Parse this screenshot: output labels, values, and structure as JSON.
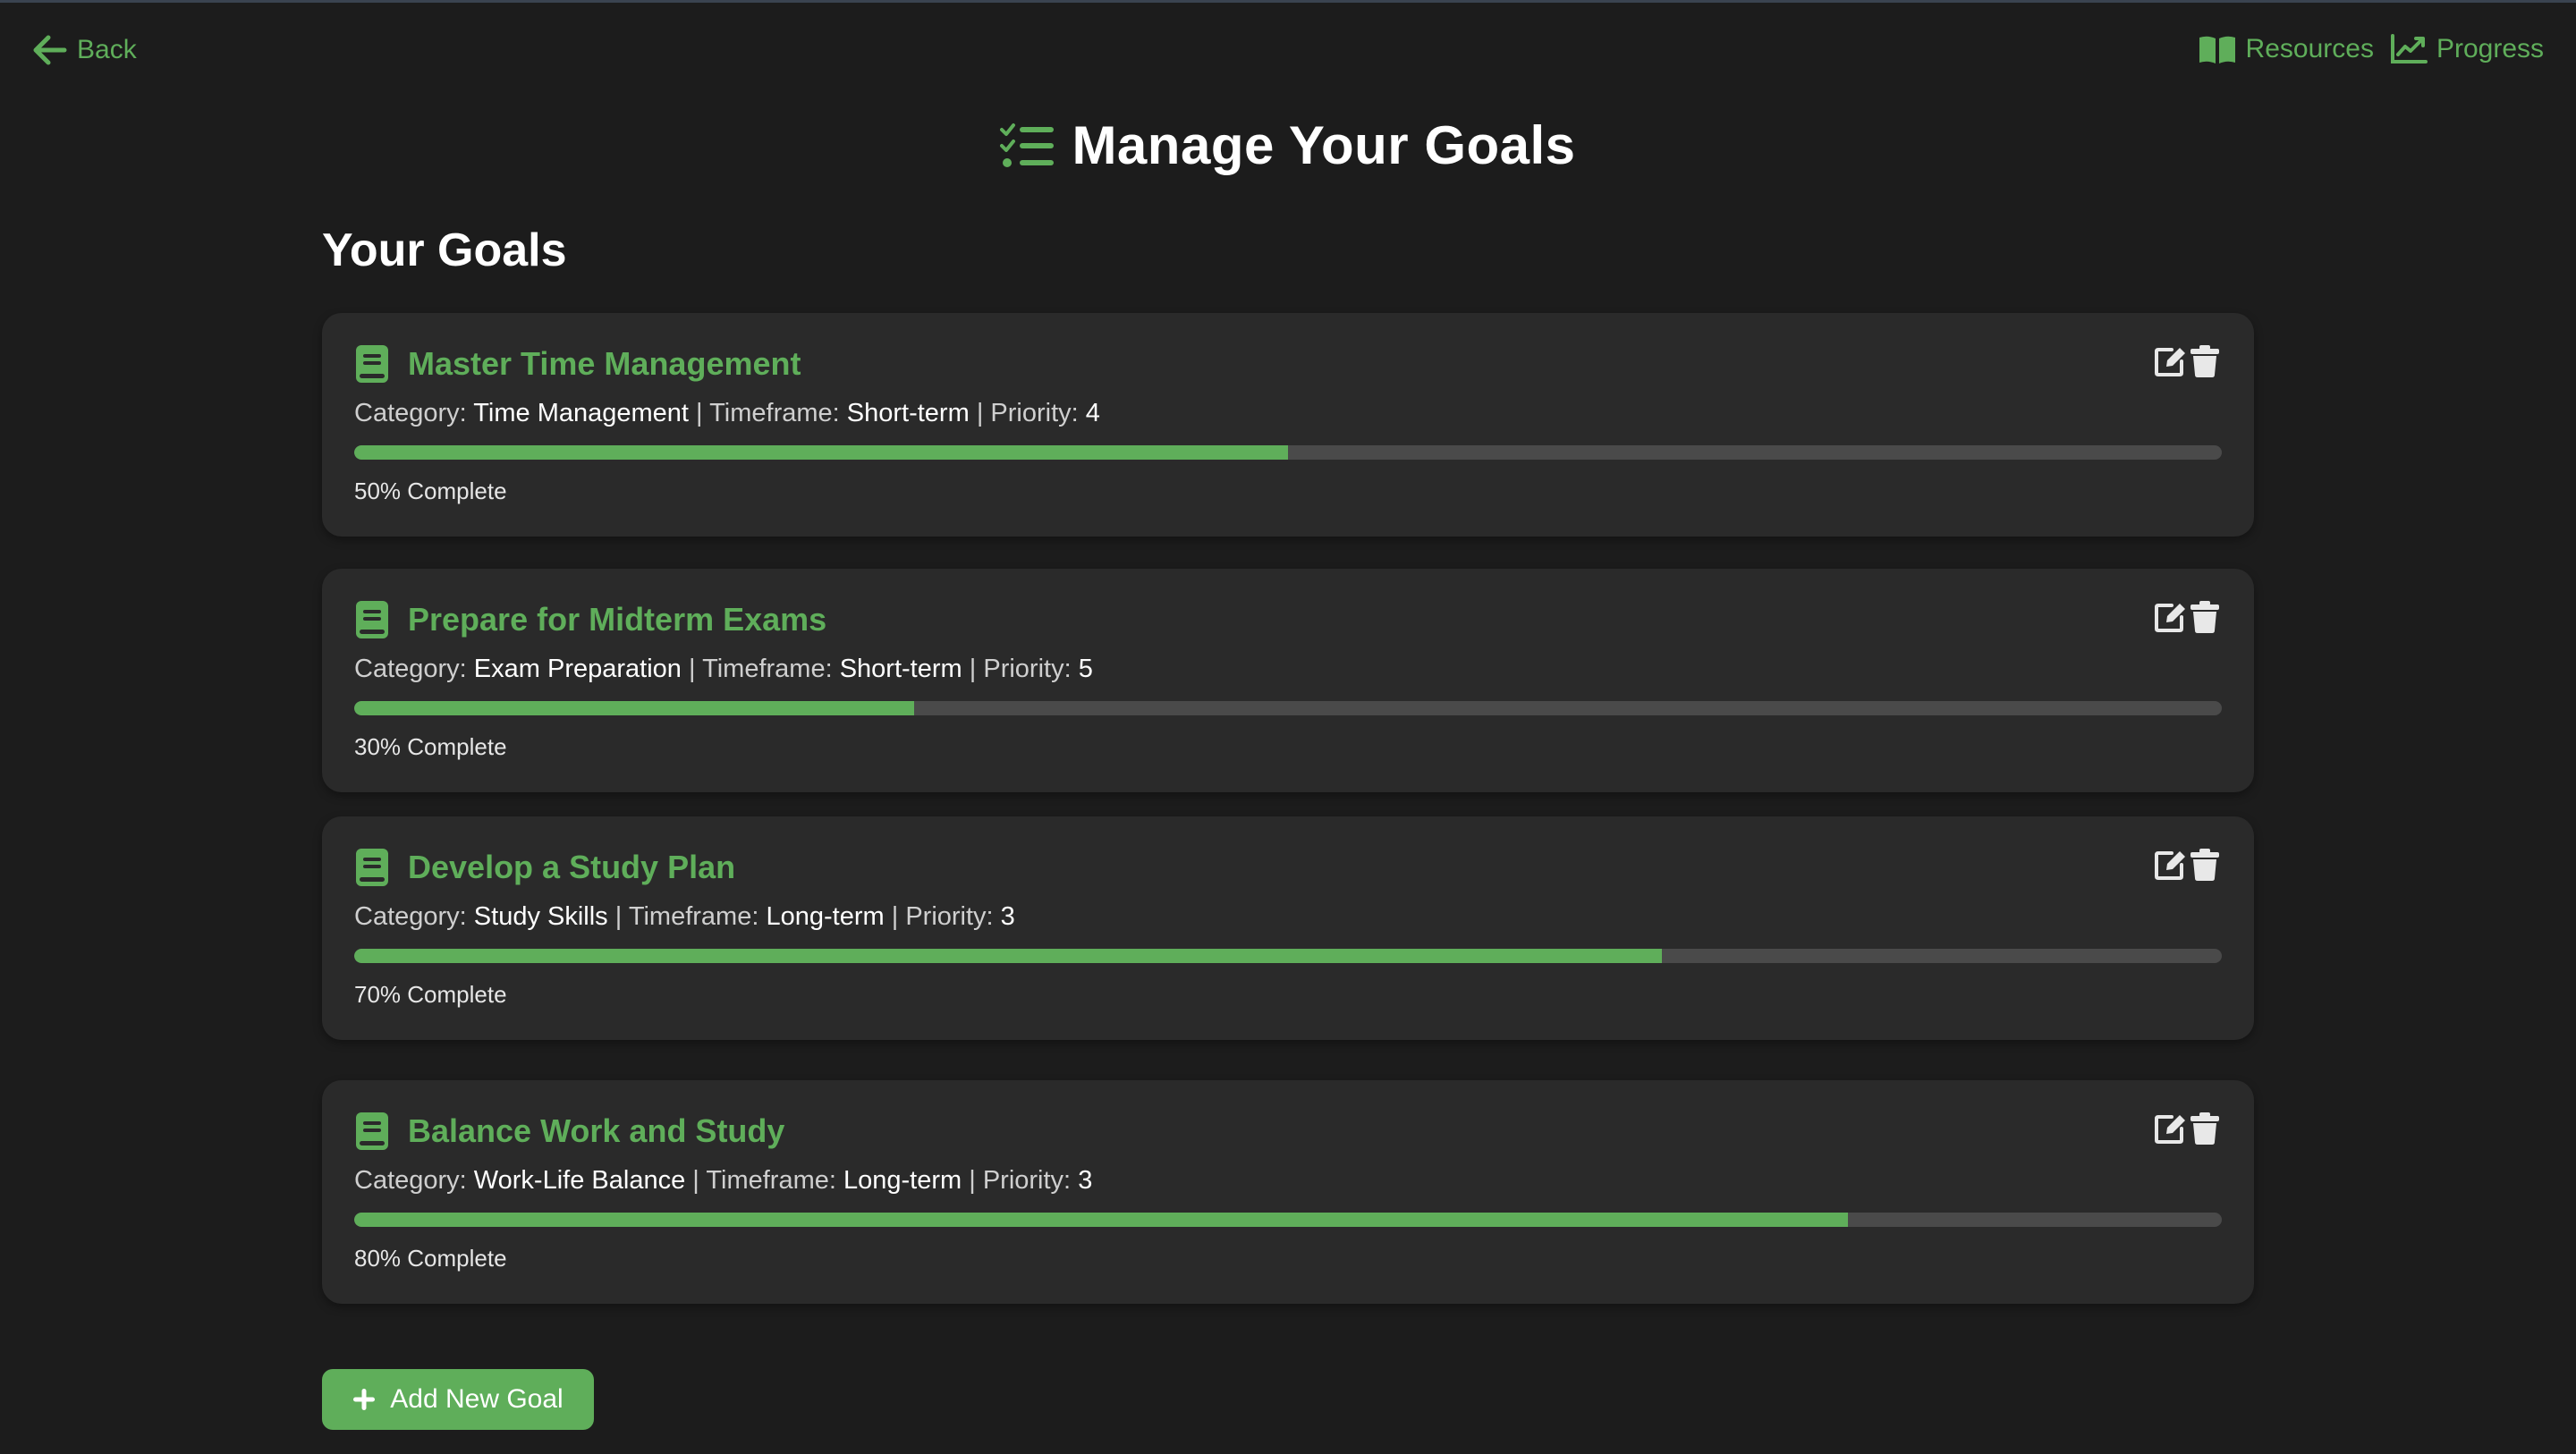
{
  "nav": {
    "back_label": "Back",
    "resources_label": "Resources",
    "progress_label": "Progress"
  },
  "page": {
    "title": "Manage Your Goals",
    "section_title": "Your Goals"
  },
  "labels": {
    "category": "Category:",
    "timeframe": "Timeframe:",
    "priority": "Priority:",
    "separator": "|"
  },
  "goals": [
    {
      "title": "Master Time Management",
      "category": "Time Management",
      "timeframe": "Short-term",
      "priority": "4",
      "progress": 50,
      "progress_text": "50% Complete"
    },
    {
      "title": "Prepare for Midterm Exams",
      "category": "Exam Preparation",
      "timeframe": "Short-term",
      "priority": "5",
      "progress": 30,
      "progress_text": "30% Complete"
    },
    {
      "title": "Develop a Study Plan",
      "category": "Study Skills",
      "timeframe": "Long-term",
      "priority": "3",
      "progress": 70,
      "progress_text": "70% Complete"
    },
    {
      "title": "Balance Work and Study",
      "category": "Work-Life Balance",
      "timeframe": "Long-term",
      "priority": "3",
      "progress": 80,
      "progress_text": "80% Complete"
    }
  ],
  "add_button_label": "Add New Goal",
  "colors": {
    "accent": "#5fae5a",
    "background": "#1c1c1c",
    "card": "#2a2a2a",
    "track": "#4a4a4a"
  },
  "icons": {
    "back": "arrow-left-icon",
    "resources": "book-open-icon",
    "progress": "chart-line-icon",
    "title": "checklist-icon",
    "goal": "book-icon",
    "edit": "edit-icon",
    "delete": "trash-icon",
    "add": "plus-icon"
  }
}
